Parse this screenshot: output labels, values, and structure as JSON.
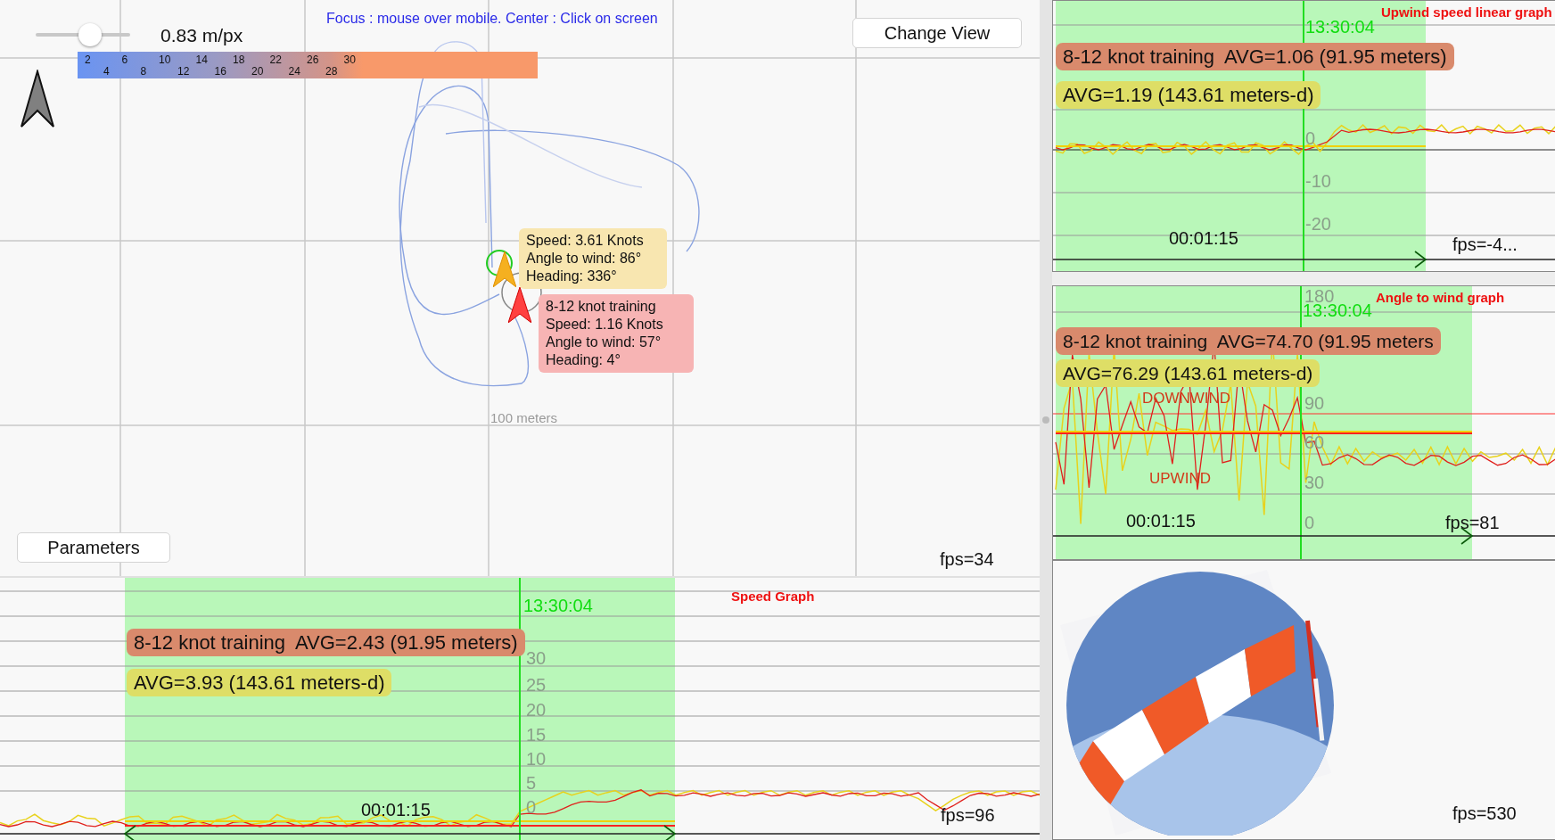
{
  "map": {
    "scale_slider": {
      "level": 0.6
    },
    "scale_reading": "0.83 m/px",
    "hint": "Focus : mouse over mobile. Center : Click on screen",
    "speed_scale": {
      "upper": [
        "2",
        "6",
        "10",
        "14",
        "18",
        "22",
        "26",
        "30"
      ],
      "lower": [
        "4",
        "8",
        "12",
        "16",
        "20",
        "24",
        "28"
      ]
    },
    "change_view_button": "Change View",
    "parameters_button": "Parameters",
    "fps": "fps=34",
    "distance_label": "100 meters",
    "tooltips": [
      {
        "kind": "current",
        "lines": [
          "Speed: 3.61 Knots",
          "Angle to wind: 86°",
          "Heading: 336°"
        ]
      },
      {
        "kind": "reference",
        "lines": [
          "8-12 knot training",
          "Speed: 1.16 Knots",
          "Angle to wind: 57°",
          "Heading: 4°"
        ]
      }
    ]
  },
  "graphs": [
    {
      "kind": "speed",
      "title": "Speed Graph",
      "time_marker": "13:30:04",
      "badges": [
        {
          "text": "8-12 knot training  AVG=2.43 (91.95 meters)",
          "color": "#d98a6c"
        },
        {
          "text": "AVG=3.93 (143.61 meters-d)",
          "color": "#dede66"
        }
      ],
      "y_labels": [
        "30",
        "25",
        "20",
        "15",
        "10",
        "5",
        "0"
      ],
      "duration": "00:01:15",
      "fps": "fps=96"
    },
    {
      "kind": "upwind",
      "title": "Upwind speed linear graph",
      "time_marker": "13:30:04",
      "badges": [
        {
          "text": "8-12 knot training  AVG=1.06 (91.95 meters)",
          "color": "#d98a6c"
        },
        {
          "text": "AVG=1.19 (143.61 meters-d)",
          "color": "#dede66"
        }
      ],
      "y_labels": [
        "0",
        "-10",
        "-20"
      ],
      "duration": "00:01:15",
      "fps": "fps=-4..."
    },
    {
      "kind": "angle",
      "title": "Angle to wind graph",
      "time_marker": "13:30:04",
      "badges": [
        {
          "text": "8-12 knot training  AVG=74.70 (91.95 meters",
          "color": "#d98a6c"
        },
        {
          "text": "AVG=76.29 (143.61 meters-d)",
          "color": "#dede66"
        }
      ],
      "y_labels": [
        "180",
        "90",
        "60",
        "30",
        "0"
      ],
      "zones": [
        "DOWNWIND",
        "UPWIND"
      ],
      "duration": "00:01:15",
      "fps": "fps=81"
    }
  ],
  "windsock": {
    "kind": "picture",
    "fps": "fps=530"
  }
}
